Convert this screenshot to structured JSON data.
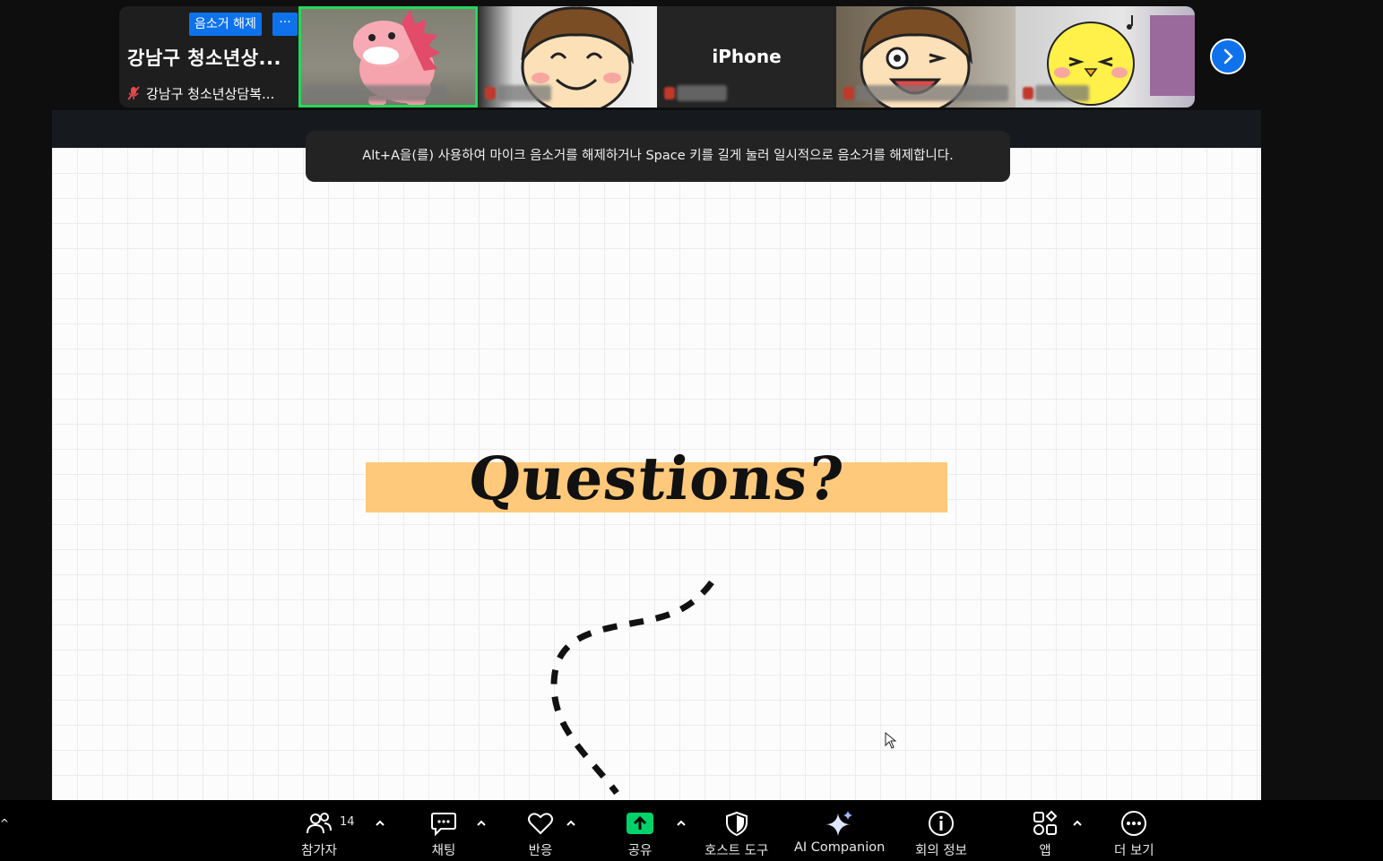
{
  "self_tile": {
    "title": "강남구 청소년상...",
    "unmute_label": "음소거 해제",
    "more_label": "···",
    "name": "강남구 청소년상담복..."
  },
  "tiles": [
    {
      "type": "avatar",
      "avatar": "pink-dinosaur",
      "active": true
    },
    {
      "type": "avatar",
      "avatar": "smiling-boy"
    },
    {
      "type": "name-only",
      "name": "iPhone"
    },
    {
      "type": "avatar",
      "avatar": "winking-boy"
    },
    {
      "type": "avatar",
      "avatar": "yellow-chick"
    }
  ],
  "toast": {
    "message": "Alt+A을(를) 사용하여 마이크 음소거를 해제하거나 Space 키를 길게 눌러 일시적으로 음소거를 해제합니다."
  },
  "slide": {
    "title": "Questions?"
  },
  "toolbar": {
    "participants_label": "참가자",
    "participants_count": "14",
    "chat_label": "채팅",
    "reactions_label": "반응",
    "share_label": "공유",
    "host_tools_label": "호스트 도구",
    "ai_label": "AI Companion",
    "info_label": "회의 정보",
    "apps_label": "앱",
    "more_label": "더 보기"
  },
  "colors": {
    "accent_blue": "#0e72ed",
    "active_speaker": "#23d959",
    "share_green": "#00d26a",
    "slide_highlight": "#ffc97c"
  }
}
